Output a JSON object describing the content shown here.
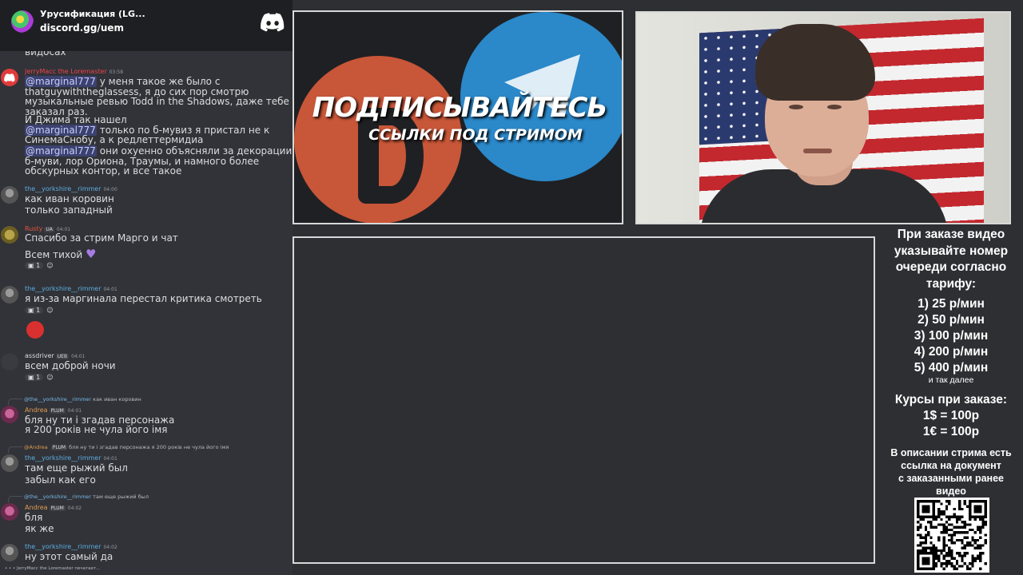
{
  "chat": {
    "server_name": "Урусификация (LG...",
    "invite_link": "discord.gg/uem",
    "messages": [
      {
        "lines": [
          "видосах"
        ]
      },
      {
        "user": "JerryMacc the Loremaster",
        "time": "03:58",
        "name_color": "#f0424a",
        "lines": [
          "у меня такое же было с",
          "thatguywiththeglassess, я до сих пор смотрю",
          "музыкальные ревью Todd in the Shadows, даже тебе",
          "заказал раз.",
          "И Джима так нашел",
          "только по б-мувиз я пристал не к",
          "СинемаСнобу, а к редлеттермидиа",
          "они охуенно объясняли за декорации в",
          "б-муви, лор Ориона, Траумы, и намного более",
          "обскурных контор, и все такое"
        ],
        "mention": "@marginal777"
      },
      {
        "user": "the__yorkshire__rimmer",
        "time": "04:00",
        "name_color": "#5dade2",
        "lines": [
          "как иван коровин",
          "только западный"
        ]
      },
      {
        "user": "Rusty",
        "badge": "UA",
        "time": "04:01",
        "name_color": "#e8553e",
        "lines": [
          "Спасибо за стрим Марго и чат",
          "Всем тихой"
        ],
        "reactions": [
          "1"
        ]
      },
      {
        "user": "the__yorkshire__rimmer",
        "time": "04:01",
        "name_color": "#5dade2",
        "lines": [
          "я из-за маргинала перестал критика смотреть"
        ],
        "reactions": [
          "1"
        ]
      },
      {
        "user": "assdriver",
        "badge": "UEB",
        "time": "04:01",
        "name_color": "#dcdde0",
        "lines": [
          "всем доброй ночи"
        ],
        "reactions": [
          "1"
        ]
      },
      {
        "reply_user": "@the__yorkshire__rimmer",
        "reply_text": "как иван коровин",
        "user": "Andrea",
        "badge": "PLUM",
        "time": "04:01",
        "name_color": "#e09b52",
        "lines": [
          "бля ну ти і згадав персонажа",
          "я 200 років не чула його імя"
        ]
      },
      {
        "reply_user": "@Andrea",
        "reply_badge": "PLUM",
        "reply_text": "бля ну ти і згадав персонажа я 200 років не чула його імя",
        "user": "the__yorkshire__rimmer",
        "time": "04:01",
        "name_color": "#5dade2",
        "lines": [
          "там еще рыжий был",
          "забыл как его"
        ]
      },
      {
        "reply_user": "@the__yorkshire__rimmer",
        "reply_text": "там еще рыжий был",
        "user": "Andrea",
        "badge": "PLUM",
        "time": "04:02",
        "name_color": "#e09b52",
        "lines": [
          "бля",
          "як же"
        ]
      },
      {
        "user": "the__yorkshire__rimmer",
        "time": "04:02",
        "name_color": "#5dade2",
        "lines": [
          "ну этот самый да"
        ]
      }
    ],
    "typing": "JerryMacc the Loremaster печатает..."
  },
  "promo": {
    "title": "ПОДПИСЫВАЙТЕСЬ",
    "subtitle": "ССЫЛКИ ПОД СТРИМОМ"
  },
  "info": {
    "heading": [
      "При заказе видео",
      "указывайте номер",
      "очереди согласно",
      "тарифу:"
    ],
    "tariffs": [
      "1) 25 р/мин",
      "2) 50 р/мин",
      "3) 100 р/мин",
      "4) 200 р/мин",
      "5) 400 р/мин"
    ],
    "tariffs_more": "и так далее",
    "rates_heading": "Курсы при заказе:",
    "rates": [
      "1$ = 100р",
      "1€ = 100р"
    ],
    "desc_note": [
      "В описании стрима есть",
      "ссылка на документ",
      "с заказанными ранее",
      "видео"
    ]
  },
  "colors": {
    "chat_bg": "#313338",
    "header_bg": "#1e1f22",
    "mention_bg": "#3c4270",
    "telegram_blue": "#2b88c9",
    "patreon_orange": "#c85638"
  }
}
